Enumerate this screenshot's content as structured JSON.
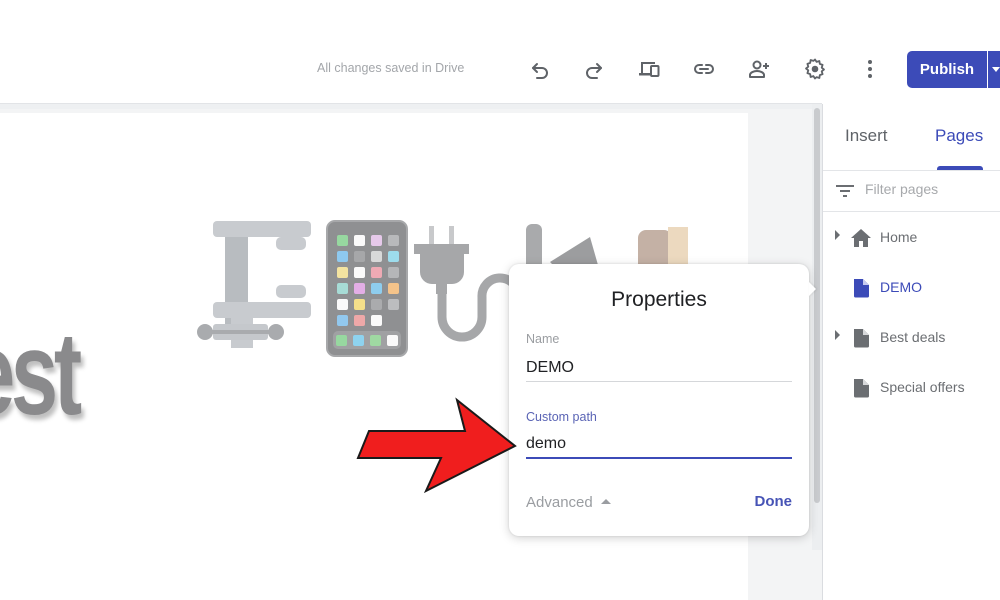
{
  "toolbar": {
    "save_status": "All changes saved in Drive",
    "icons": [
      "undo-icon",
      "redo-icon",
      "preview-devices-icon",
      "link-icon",
      "share-add-person-icon",
      "settings-gear-icon",
      "more-vert-icon"
    ],
    "publish_label": "Publish",
    "accent_color": "#3c4bb8"
  },
  "canvas": {
    "hero_text": "est",
    "images": [
      "clamp-image",
      "smartphone-image",
      "plug-image"
    ]
  },
  "right_panel": {
    "tabs": [
      {
        "label": "Insert",
        "active": false
      },
      {
        "label": "Pages",
        "active": true
      }
    ],
    "filter_placeholder": "Filter pages",
    "pages": [
      {
        "label": "Home",
        "icon": "home-icon",
        "expandable": true,
        "active": false
      },
      {
        "label": "DEMO",
        "icon": "page-icon",
        "expandable": false,
        "active": true
      },
      {
        "label": "Best deals",
        "icon": "page-icon",
        "expandable": true,
        "active": false
      },
      {
        "label": "Special offers",
        "icon": "page-icon",
        "expandable": false,
        "active": false
      }
    ]
  },
  "properties": {
    "title": "Properties",
    "name_label": "Name",
    "name_value": "DEMO",
    "path_label": "Custom path",
    "path_value": "demo",
    "advanced_label": "Advanced",
    "done_label": "Done"
  },
  "annotation": {
    "arrow_color": "#f01e1e"
  }
}
